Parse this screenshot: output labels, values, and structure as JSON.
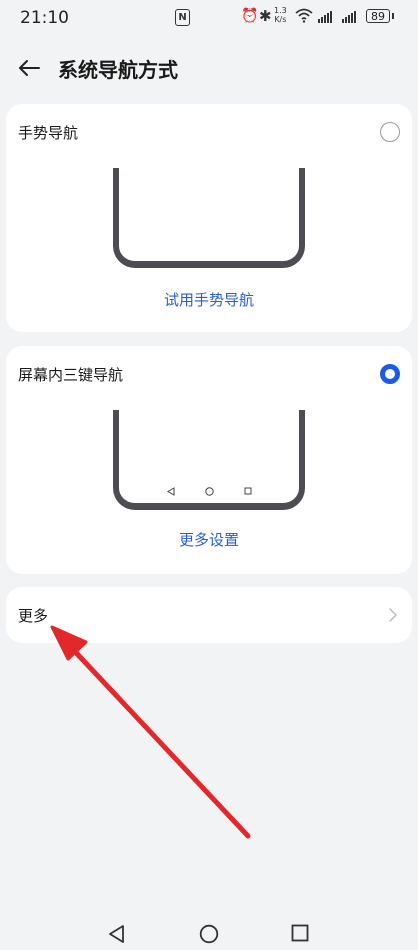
{
  "status_bar": {
    "time": "21:10",
    "nfc": "N",
    "net_speed_value": "1.3",
    "net_speed_unit": "K/s",
    "battery": "89"
  },
  "header": {
    "title": "系统导航方式"
  },
  "options": [
    {
      "label": "手势导航",
      "selected": false,
      "link": "试用手势导航"
    },
    {
      "label": "屏幕内三键导航",
      "selected": true,
      "link": "更多设置"
    }
  ],
  "more": {
    "label": "更多"
  },
  "colors": {
    "accent": "#1e5ae6",
    "annotation_arrow": "#e3282b"
  },
  "icons": [
    "back-arrow-icon",
    "alarm-icon",
    "bluetooth-icon",
    "wifi-icon",
    "signal-icon",
    "battery-icon",
    "chevron-right-icon",
    "triangle-back-icon",
    "circle-home-icon",
    "square-recents-icon"
  ]
}
